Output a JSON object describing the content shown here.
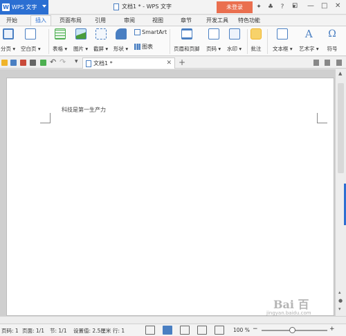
{
  "app": {
    "name": "WPS 文字",
    "window_title": "文档1 * - WPS 文字",
    "login_label": "未登录",
    "colors": {
      "brand": "#2b6fd2",
      "login": "#ea6f4f"
    }
  },
  "menu_tabs": [
    {
      "label": "开始"
    },
    {
      "label": "插入"
    },
    {
      "label": "页面布局"
    },
    {
      "label": "引用"
    },
    {
      "label": "审阅"
    },
    {
      "label": "视图"
    },
    {
      "label": "章节"
    },
    {
      "label": "开发工具"
    },
    {
      "label": "特色功能"
    }
  ],
  "active_tab": "插入",
  "ribbon": {
    "buttons": [
      {
        "label": "分页 ▾",
        "icon": "page-break-icon",
        "color": "#4a7fc2"
      },
      {
        "label": "空白页 ▾",
        "icon": "blank-page-icon",
        "color": "#4a7fc2"
      },
      {
        "label": "表格 ▾",
        "icon": "table-icon",
        "color": "#4caf50"
      },
      {
        "label": "图片 ▾",
        "icon": "picture-icon",
        "color": "#4a9d3b"
      },
      {
        "label": "截屏 ▾",
        "icon": "screenshot-icon",
        "color": "#4a7fc2"
      },
      {
        "label": "形状 ▾",
        "icon": "shape-icon",
        "color": "#4a7fc2"
      },
      {
        "label": "页眉和页脚",
        "icon": "header-footer-icon",
        "color": "#4a7fc2"
      },
      {
        "label": "页码 ▾",
        "icon": "page-number-icon",
        "color": "#4a7fc2"
      },
      {
        "label": "水印 ▾",
        "icon": "watermark-icon",
        "color": "#4a7fc2"
      },
      {
        "label": "批注",
        "icon": "comment-icon",
        "color": "#f0b429"
      },
      {
        "label": "文本框 ▾",
        "icon": "textbox-icon",
        "color": "#4a7fc2"
      },
      {
        "label": "艺术字 ▾",
        "icon": "wordart-icon",
        "color": "#4a7fc2"
      },
      {
        "label": "符号",
        "icon": "symbol-icon",
        "color": "#4a7fc2"
      }
    ],
    "smartart_label": "SmartArt",
    "chart_label": "图表"
  },
  "doc_tab": {
    "label": "文档1 *"
  },
  "document": {
    "text": "科技是第一生产力"
  },
  "status": {
    "page_num": "页码: 1",
    "pages": "页面: 1/1",
    "section": "节: 1/1",
    "setting": "设置值: 2.5厘米",
    "row": "行: 1",
    "zoom": "100 %"
  },
  "watermark": {
    "text": "Bai 百",
    "sub": "jingyan.baidu.com"
  }
}
